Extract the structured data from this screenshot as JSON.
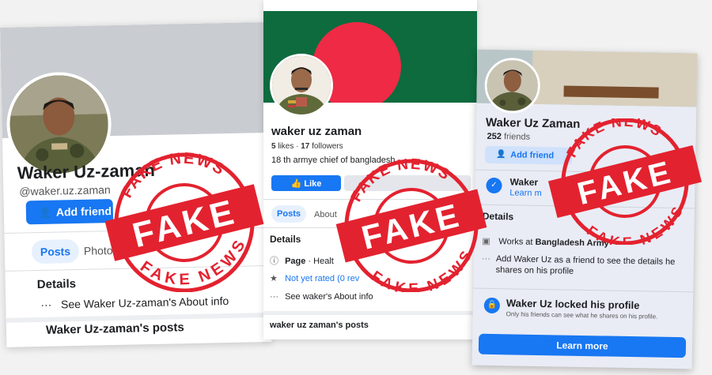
{
  "colors": {
    "facebook_blue": "#1877f2",
    "stamp_red": "#e3222f",
    "flag_green": "#0d6b3e",
    "flag_red": "#ee2a45"
  },
  "screenshot1": {
    "name": "Waker Uz-zaman",
    "handle": "@waker.uz.zaman",
    "add_friend_label": "Add friend",
    "tabs": [
      "Posts",
      "Photo"
    ],
    "details_heading": "Details",
    "about_line": "See Waker Uz-zaman's About info",
    "posts_heading": "Waker Uz-zaman's posts",
    "icons": [
      "add-friend-icon",
      "more-dots-icon"
    ]
  },
  "screenshot2": {
    "name": "waker uz zaman",
    "likes": "5",
    "likes_label": "likes",
    "followers": "17",
    "followers_label": "followers",
    "bio": "18 th armye chief of bangladesh",
    "like_button_label": "Like",
    "tabs": [
      "Posts",
      "About"
    ],
    "details_heading": "Details",
    "page_label": "Page",
    "page_category": "Healt",
    "rating": "Not yet rated (0 rev",
    "about_line": "See waker's About info",
    "posts_heading": "waker uz zaman's posts",
    "icons": [
      "info-icon",
      "star-icon",
      "more-dots-icon",
      "like-thumb-icon"
    ]
  },
  "screenshot3": {
    "name": "Waker Uz Zaman",
    "friends_count": "252",
    "friends_label": "friends",
    "add_friend_label": "Add friend",
    "notice_title": "Waker",
    "notice_link": "Learn m",
    "details_heading": "Details",
    "works_at_prefix": "Works at",
    "works_at_place": "Bangladesh Army",
    "add_info_text": "Add Waker Uz as a friend to see the details he shares on his profile",
    "locked_title": "Waker Uz locked his profile",
    "locked_subtitle": "Only his friends can see what he shares on his profile.",
    "learn_more_label": "Learn more",
    "icons": [
      "shield-icon",
      "briefcase-icon",
      "more-dots-icon",
      "lock-shield-icon"
    ]
  },
  "stamps": [
    {
      "top_text": "FAKE NEWS",
      "main_text": "FAKE",
      "bottom_text": "FAKE NEWS"
    },
    {
      "top_text": "FAKE NEWS",
      "main_text": "FAKE",
      "bottom_text": "FAKE NEWS"
    },
    {
      "top_text": "FAKE NEWS",
      "main_text": "FAKE",
      "bottom_text": "FAKE NEWS"
    }
  ]
}
